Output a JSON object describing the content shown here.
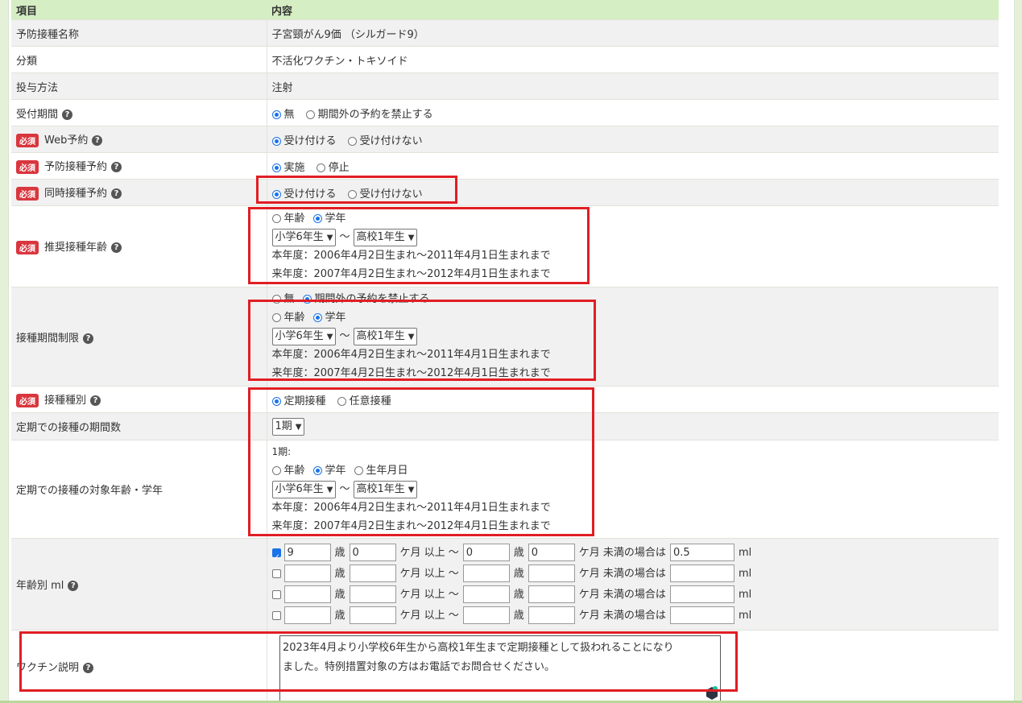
{
  "header": {
    "col1": "項目",
    "col2": "内容"
  },
  "required_badge": "必須",
  "help_glyph": "?",
  "rows": {
    "name": {
      "label": "予防接種名称",
      "value": "子宮頸がん9価 （シルガード9）"
    },
    "category": {
      "label": "分類",
      "value": "不活化ワクチン・トキソイド"
    },
    "method": {
      "label": "投与方法",
      "value": "注射"
    },
    "reception": {
      "label": "受付期間",
      "opt1": "無",
      "opt2": "期間外の予約を禁止する"
    },
    "web": {
      "label": "Web予約",
      "opt1": "受け付ける",
      "opt2": "受け付けない"
    },
    "booking": {
      "label": "予防接種予約",
      "opt1": "実施",
      "opt2": "停止"
    },
    "simultaneous": {
      "label": "同時接種予約",
      "opt1": "受け付ける",
      "opt2": "受け付けない"
    },
    "recommended": {
      "label": "推奨接種年齢",
      "opt1": "年齢",
      "opt2": "学年",
      "from": "小学6年生",
      "to": "高校1年生",
      "this_year": "本年度：2006年4月2日生まれ〜2011年4月1日生まれまで",
      "next_year": "来年度：2007年4月2日生まれ〜2012年4月1日生まれまで"
    },
    "period_limit": {
      "label": "接種期間制限",
      "top_opt1": "無",
      "top_opt2": "期間外の予約を禁止する",
      "opt1": "年齢",
      "opt2": "学年",
      "from": "小学6年生",
      "to": "高校1年生",
      "this_year": "本年度：2006年4月2日生まれ〜2011年4月1日生まれまで",
      "next_year": "来年度：2007年4月2日生まれ〜2012年4月1日生まれまで"
    },
    "type": {
      "label": "接種種別",
      "opt1": "定期接種",
      "opt2": "任意接種"
    },
    "period_count": {
      "label": "定期での接種の期間数",
      "value": "1期"
    },
    "target_age": {
      "label": "定期での接種の対象年齢・学年",
      "period": "1期:",
      "opt1": "年齢",
      "opt2": "学年",
      "opt3": "生年月日",
      "from": "小学6年生",
      "to": "高校1年生",
      "this_year": "本年度：2006年4月2日生まれ〜2011年4月1日生まれまで",
      "next_year": "来年度：2007年4月2日生まれ〜2012年4月1日生まれまで"
    },
    "dose": {
      "label": "年齢別 ml",
      "unit_age": "歳",
      "unit_month_from": "ケ月 以上 〜",
      "unit_age2": "歳",
      "unit_month_to": "ケ月 未満の場合は",
      "unit_ml": "ml",
      "entries": [
        {
          "checked": true,
          "age_from": "9",
          "month_from": "0",
          "age_to": "0",
          "month_to": "0",
          "ml": "0.5"
        },
        {
          "checked": false,
          "age_from": "",
          "month_from": "",
          "age_to": "",
          "month_to": "",
          "ml": ""
        },
        {
          "checked": false,
          "age_from": "",
          "month_from": "",
          "age_to": "",
          "month_to": "",
          "ml": ""
        },
        {
          "checked": false,
          "age_from": "",
          "month_from": "",
          "age_to": "",
          "month_to": "",
          "ml": ""
        }
      ]
    },
    "description": {
      "label": "ワクチン説明",
      "line1": "2023年4月より小学校6年生から高校1年生まで定期接種として扱われることになり",
      "line2": "ました。特例措置対象の方はお電話でお問合せください。"
    }
  },
  "colors": {
    "header_bg": "#d5eec3",
    "badge": "#d9363e",
    "highlight": "#e01e24",
    "radio_on": "#1a73e8"
  }
}
